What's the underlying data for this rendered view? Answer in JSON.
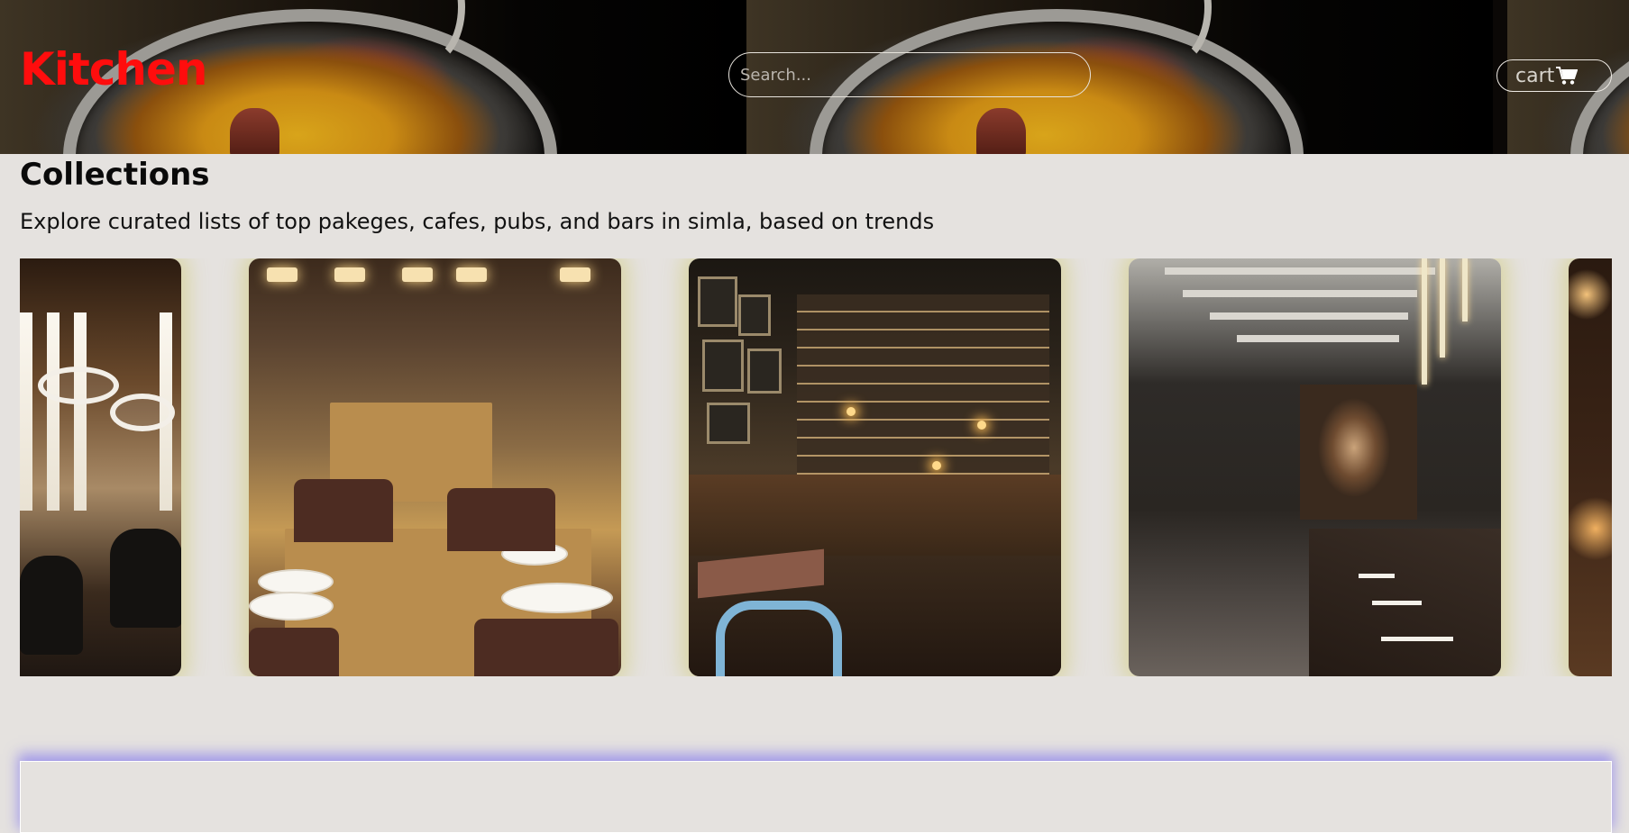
{
  "header": {
    "brand": "Kitchen",
    "search_placeholder": "Search...",
    "cart_label": "cart",
    "cart_icon": "shopping-cart-icon"
  },
  "colors": {
    "brand": "#ff0d0d",
    "page_background": "#e5e2df",
    "card_glow": "#d7d296",
    "panel_glow": "#8c82eb"
  },
  "collections": {
    "title": "Collections",
    "subtitle": "Explore curated lists of top pakeges, cafes, pubs, and bars in simla, based on trends",
    "cards": [
      {
        "image": "restaurant-photo-modern-dining"
      },
      {
        "image": "restaurant-photo-table-settings"
      },
      {
        "image": "restaurant-photo-pub-interior"
      },
      {
        "image": "restaurant-photo-long-dining-hall"
      },
      {
        "image": "restaurant-photo-warm-lights"
      }
    ]
  }
}
